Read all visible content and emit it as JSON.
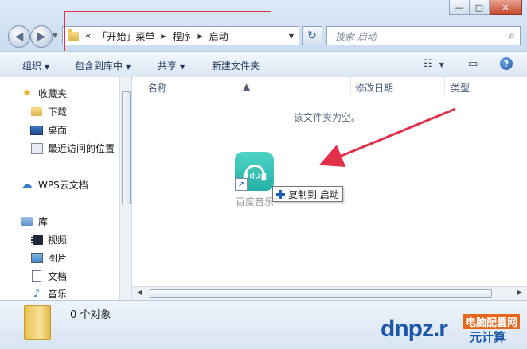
{
  "window": {
    "caption": {
      "minimize": "—",
      "maximize": "□",
      "close": "✕"
    }
  },
  "nav": {
    "back": "◀",
    "forward": "▶",
    "history_drop": "▼"
  },
  "address": {
    "prefix": "«",
    "crumbs": [
      "「开始」菜单",
      "程序",
      "启动"
    ],
    "separator": "▶",
    "dropdown": "▼",
    "refresh": "↻"
  },
  "search": {
    "placeholder": "搜索 启动",
    "icon": "⌕"
  },
  "toolbar": {
    "organize": "组织",
    "include_in_library": "包含到库中",
    "share": "共享",
    "new_folder": "新建文件夹",
    "caret": "▼",
    "help": "?"
  },
  "sidebar": {
    "favorites_label": "收藏夹",
    "favorites": [
      "下载",
      "桌面",
      "最近访问的位置"
    ],
    "wps_label": "WPS云文档",
    "library_label": "库",
    "libraries": [
      "视频",
      "图片",
      "文档",
      "音乐"
    ]
  },
  "content": {
    "columns": {
      "name": "名称",
      "date": "修改日期",
      "type": "类型"
    },
    "empty_text": "该文件夹为空。",
    "dragged_item_label": "百度音乐",
    "drag_tooltip": "复制到 启动"
  },
  "details": {
    "count": "0 个对象"
  },
  "watermark": {
    "main": "dnpz.r",
    "top": "电脑配置网",
    "bottom": "元计算"
  },
  "colors": {
    "annotation_box": "#e0304a",
    "arrow": "#e0304a",
    "accent": "#1c56a8"
  }
}
